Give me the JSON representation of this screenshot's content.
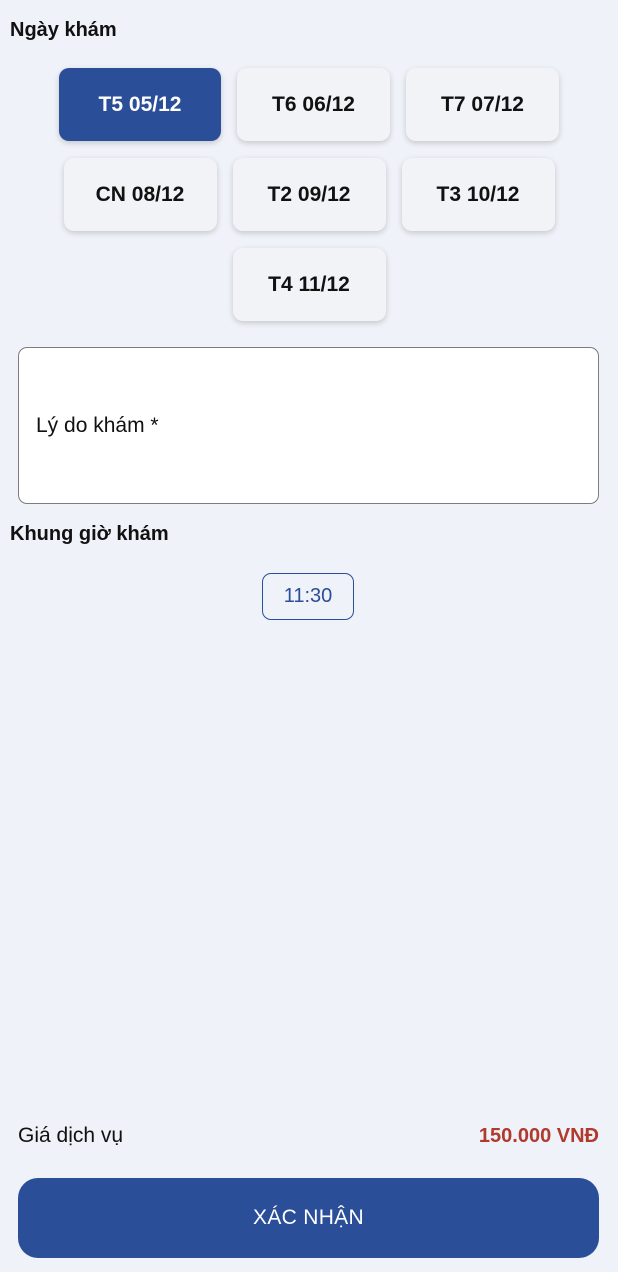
{
  "date_section": {
    "title": "Ngày khám",
    "dates": [
      {
        "label": "T5 05/12",
        "selected": true
      },
      {
        "label": "T6 06/12",
        "selected": false
      },
      {
        "label": "T7 07/12",
        "selected": false
      },
      {
        "label": "CN 08/12",
        "selected": false
      },
      {
        "label": "T2 09/12",
        "selected": false
      },
      {
        "label": "T3 10/12",
        "selected": false
      },
      {
        "label": "T4 11/12",
        "selected": false
      }
    ]
  },
  "reason": {
    "label": "Lý do khám *"
  },
  "time_section": {
    "title": "Khung giờ khám",
    "slots": [
      {
        "label": "11:30"
      }
    ]
  },
  "price": {
    "label": "Giá dịch vụ",
    "value": "150.000 VNĐ"
  },
  "confirm": {
    "label": "XÁC NHẬN"
  },
  "colors": {
    "primary": "#2a4e98",
    "price": "#b03a2e",
    "background": "#eff2f8"
  }
}
